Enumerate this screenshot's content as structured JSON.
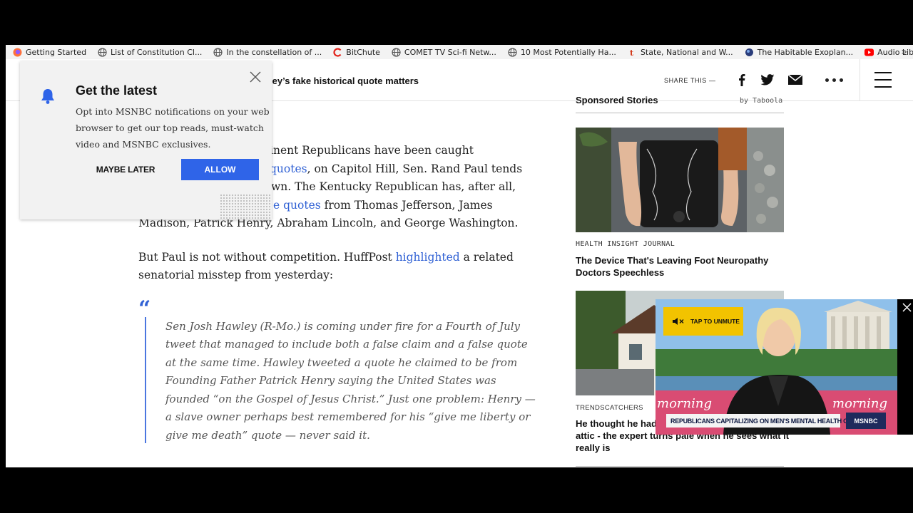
{
  "bookmarks": [
    {
      "label": "Getting Started",
      "icon": "firefox-icon"
    },
    {
      "label": "List of Constitution Cl...",
      "icon": "globe-icon"
    },
    {
      "label": "In the constellation of ...",
      "icon": "globe-icon"
    },
    {
      "label": "BitChute",
      "icon": "bitchute-icon"
    },
    {
      "label": "COMET TV Sci-fi Netw...",
      "icon": "globe-icon"
    },
    {
      "label": "10 Most Potentially Ha...",
      "icon": "globe-icon"
    },
    {
      "label": "State, National and W...",
      "icon": "t-icon"
    },
    {
      "label": "The Habitable Exoplan...",
      "icon": "planet-icon"
    },
    {
      "label": "Audio Library - YouTube",
      "icon": "youtube-icon"
    }
  ],
  "bookmarks_more": "»",
  "header": {
    "title": "ley’s fake historical quote matters",
    "share_label": "SHARE THIS —"
  },
  "popup": {
    "title": "Get the latest",
    "body_lines": [
      "Opt into MSNBC notifications on your web",
      "browser to get our top reads, must-watch",
      "video and MSNBC exclusives."
    ],
    "maybe_later": "MAYBE LATER",
    "allow": "ALLOW"
  },
  "article": {
    "p1_line1": "inent Republicans have been caught",
    "p1_link1": "quotes",
    "p1_line2_rest": ", on Capitol Hill, Sen. Rand Paul tends",
    "p1_line3": "wn. The Kentucky Republican has, after all,",
    "p1_link2": "e quotes",
    "p1_line4_rest": " from Thomas Jefferson, James",
    "p1_line5": "Madison, Patrick Henry, Abraham Lincoln, and George Washington.",
    "p2_line1_pre": "But Paul is not without competition. HuffPost ",
    "p2_link": "highlighted",
    "p2_line1_post": " a related",
    "p2_line2": "senatorial misstep from yesterday:",
    "quote_mark": "“",
    "quote_lines": [
      "Sen Josh Hawley (R-Mo.) is coming under fire for a Fourth of July",
      "tweet that managed to include both a false claim and a false quote",
      "at the same time. Hawley tweeted a quote he claimed to be from",
      "Founding Father Patrick Henry saying the United States was",
      "founded “on the Gospel of Jesus Christ.” Just one problem: Henry —",
      "a slave owner perhaps best remembered for his “give me liberty or",
      "give me death” quote — never said it."
    ]
  },
  "sidebar": {
    "title": "Sponsored Stories",
    "by": "by Taboola",
    "card1": {
      "source": "HEALTH INSIGHT JOURNAL",
      "title_lines": [
        "The Device That's Leaving Foot Neuropathy",
        "Doctors Speechless"
      ]
    },
    "card2": {
      "source": "TRENDSCATCHERS",
      "title_lines": [
        "He thought he had",
        "attic - the expert turns pale when he sees what it",
        "really is"
      ]
    }
  },
  "video": {
    "unmute": "TAP TO UNMUTE",
    "chyron": "REPUBLICANS CAPITALIZING ON MEN'S MENTAL HEALTH CRISIS",
    "logo": "MSNBC",
    "backdrop_text": "morning"
  },
  "colors": {
    "link": "#3061d4",
    "allow_button": "#2f64e8",
    "unmute_button": "#f2c300"
  }
}
